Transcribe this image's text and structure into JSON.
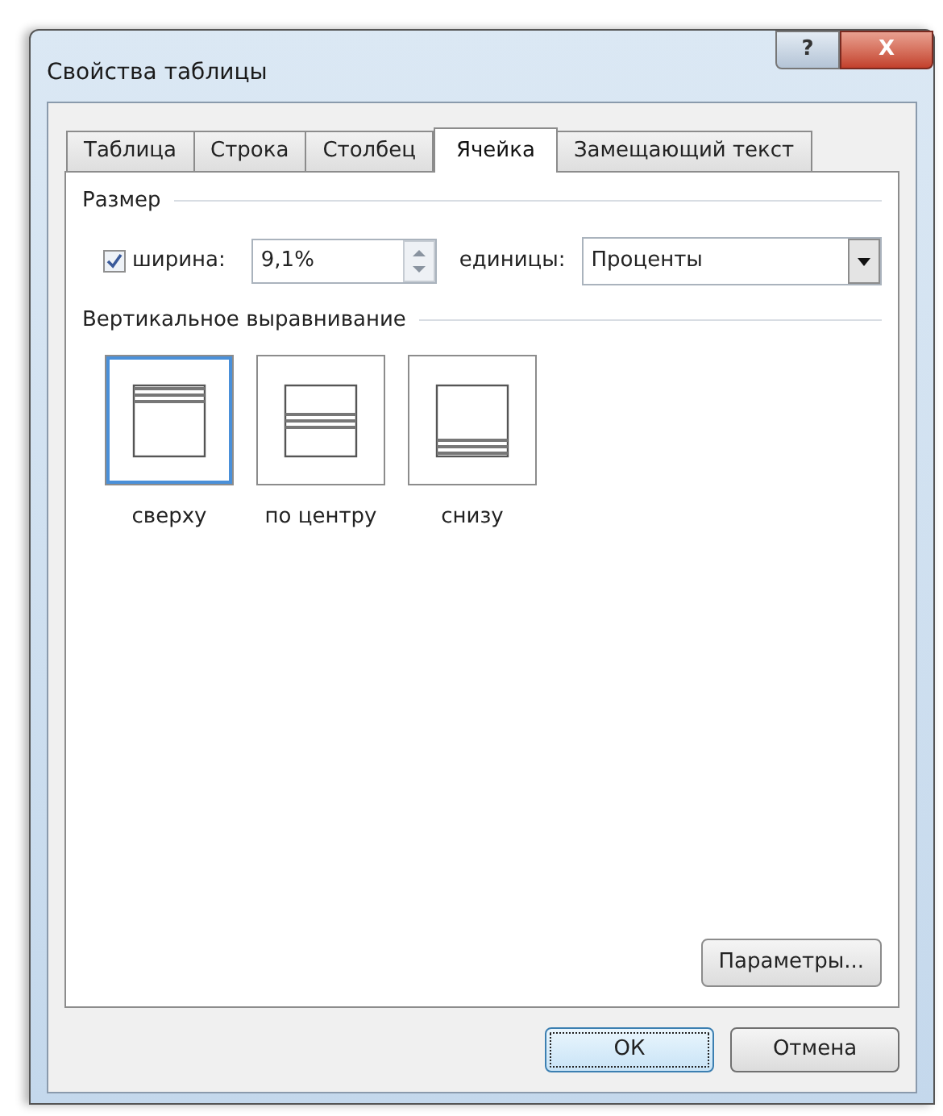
{
  "window": {
    "title": "Свойства таблицы"
  },
  "title_buttons": [
    {
      "kind": "help",
      "label": "?"
    },
    {
      "kind": "close",
      "label": "X"
    }
  ],
  "tabs": [
    {
      "label": "Таблица",
      "selected": false
    },
    {
      "label": "Строка",
      "selected": false
    },
    {
      "label": "Столбец",
      "selected": false
    },
    {
      "label": "Ячейка",
      "selected": true
    },
    {
      "label": "Замещающий текст",
      "selected": false
    }
  ],
  "size": {
    "heading": "Размер",
    "width_checkbox": {
      "label": "ширина:",
      "checked": true
    },
    "width_value": "9,1%",
    "units_label": "единицы:",
    "units_value": "Проценты"
  },
  "alignment": {
    "heading": "Вертикальное выравнивание",
    "options": [
      {
        "kind": "top",
        "label": "сверху",
        "selected": true
      },
      {
        "kind": "center",
        "label": "по центру",
        "selected": false
      },
      {
        "kind": "bottom",
        "label": "снизу",
        "selected": false
      }
    ]
  },
  "options_button": "Параметры...",
  "buttons": [
    {
      "label": "ОК",
      "default": true
    },
    {
      "label": "Отмена",
      "default": false
    }
  ]
}
